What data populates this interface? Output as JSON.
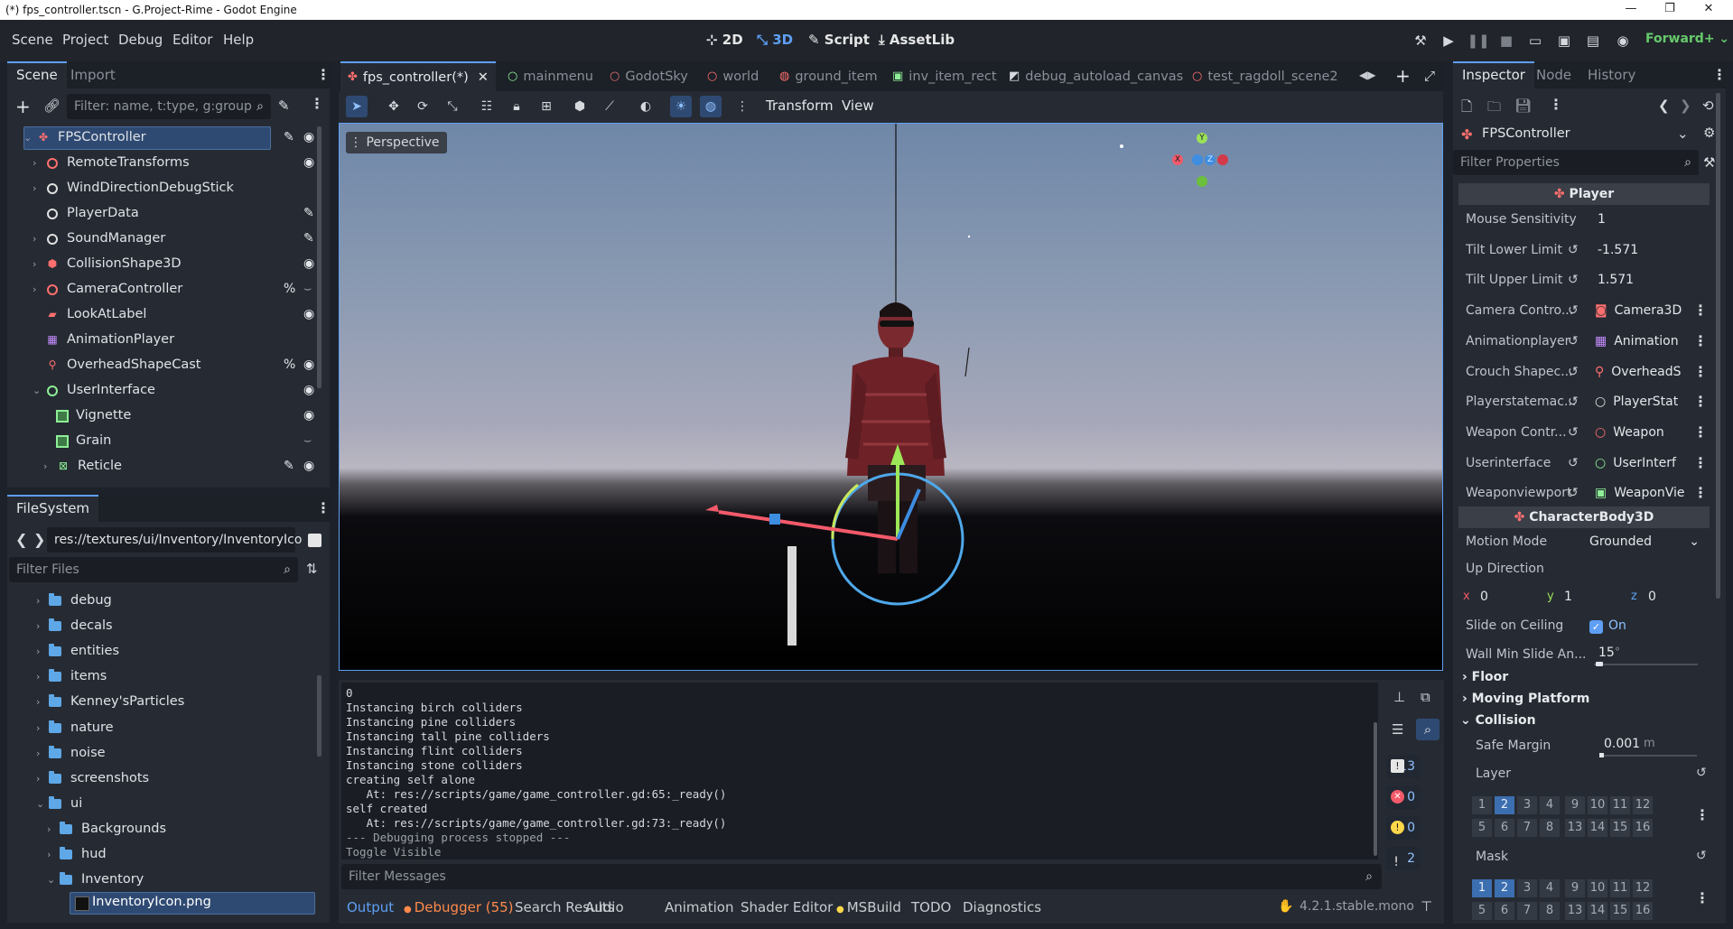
{
  "window": {
    "title": "(*) fps_controller.tscn - G.Project-Rime - Godot Engine"
  },
  "menu": [
    "Scene",
    "Project",
    "Debug",
    "Editor",
    "Help"
  ],
  "workspaces": {
    "w2d": "2D",
    "w3d": "3D",
    "script": "Script",
    "assetlib": "AssetLib"
  },
  "renderer": "Forward+",
  "scene_dock": {
    "tabs": [
      "Scene",
      "Import"
    ],
    "filter_placeholder": "Filter: name, t:type, g:group",
    "nodes": [
      {
        "name": "FPSController"
      },
      {
        "name": "RemoteTransforms"
      },
      {
        "name": "WindDirectionDebugStick"
      },
      {
        "name": "PlayerData"
      },
      {
        "name": "SoundManager"
      },
      {
        "name": "CollisionShape3D"
      },
      {
        "name": "CameraController",
        "badge": "%"
      },
      {
        "name": "LookAtLabel"
      },
      {
        "name": "AnimationPlayer"
      },
      {
        "name": "OverheadShapeCast",
        "badge": "%"
      },
      {
        "name": "UserInterface"
      },
      {
        "name": "Vignette"
      },
      {
        "name": "Grain"
      },
      {
        "name": "Reticle"
      }
    ]
  },
  "filesystem": {
    "title": "FileSystem",
    "path": "res://textures/ui/Inventory/InventoryIco",
    "filter_placeholder": "Filter Files",
    "items": [
      "debug",
      "decals",
      "entities",
      "items",
      "Kenney'sParticles",
      "nature",
      "noise",
      "screenshots",
      "ui",
      "Backgrounds",
      "hud",
      "Inventory"
    ],
    "selected_file": "InventoryIcon.png"
  },
  "editor_tabs": [
    "fps_controller(*)",
    "mainmenu",
    "GodotSky",
    "world",
    "ground_item",
    "inv_item_rect",
    "debug_autoload_canvas",
    "test_ragdoll_scene2"
  ],
  "toolbar": {
    "transform": "Transform",
    "view": "View"
  },
  "viewport": {
    "mode": "Perspective",
    "gizmo": {
      "x": "X",
      "y": "Y",
      "z": "Z"
    }
  },
  "console": {
    "lines": [
      "0",
      "Instancing birch colliders",
      "Instancing pine colliders",
      "Instancing tall pine colliders",
      "Instancing flint colliders",
      "Instancing stone colliders",
      "creating self alone",
      "   At: res://scripts/game/game_controller.gd:65:_ready()",
      "self created",
      "   At: res://scripts/game/game_controller.gd:73:_ready()",
      "--- Debugging process stopped ---",
      "Toggle Visible"
    ],
    "filter_placeholder": "Filter Messages",
    "counts": {
      "messages": "13",
      "errors": "0",
      "warnings": "0",
      "info": "2"
    }
  },
  "bottom_tabs": [
    "Output",
    "Debugger (55)",
    "Search Results",
    "Audio",
    "Animation",
    "Shader Editor",
    "MSBuild",
    "TODO",
    "Diagnostics"
  ],
  "version": "4.2.1.stable.mono",
  "inspector": {
    "tabs": [
      "Inspector",
      "Node",
      "History"
    ],
    "object": "FPSController",
    "filter_placeholder": "Filter Properties",
    "section_player": "Player",
    "props": [
      {
        "label": "Mouse Sensitivity",
        "value": "1"
      },
      {
        "label": "Tilt Lower Limit",
        "value": "-1.571"
      },
      {
        "label": "Tilt Upper Limit",
        "value": "1.571"
      },
      {
        "label": "Camera Contro...",
        "value": "Camera3D"
      },
      {
        "label": "Animationplayer",
        "value": "Animation"
      },
      {
        "label": "Crouch Shapec...",
        "value": "OverheadS"
      },
      {
        "label": "Playerstatemac...",
        "value": "PlayerStat"
      },
      {
        "label": "Weapon Contr...",
        "value": "Weapon"
      },
      {
        "label": "Userinterface",
        "value": "UserInterf"
      },
      {
        "label": "Weaponviewport",
        "value": "WeaponVie"
      }
    ],
    "section_body": "CharacterBody3D",
    "motion_mode": {
      "label": "Motion Mode",
      "value": "Grounded"
    },
    "up_direction": {
      "label": "Up Direction",
      "x": "0",
      "y": "1",
      "z": "0"
    },
    "slide_on_ceiling": {
      "label": "Slide on Ceiling",
      "value": "On"
    },
    "wall_min_slide": {
      "label": "Wall Min Slide An...",
      "value": "15",
      "unit": "°"
    },
    "groups": {
      "floor": "Floor",
      "moving_platform": "Moving Platform",
      "collision": "Collision"
    },
    "safe_margin": {
      "label": "Safe Margin",
      "value": "0.001",
      "unit": "m"
    },
    "layer_label": "Layer",
    "mask_label": "Mask",
    "layer_cells": [
      "1",
      "2",
      "3",
      "4",
      "9",
      "10",
      "11",
      "12",
      "5",
      "6",
      "7",
      "8",
      "13",
      "14",
      "15",
      "16"
    ]
  }
}
